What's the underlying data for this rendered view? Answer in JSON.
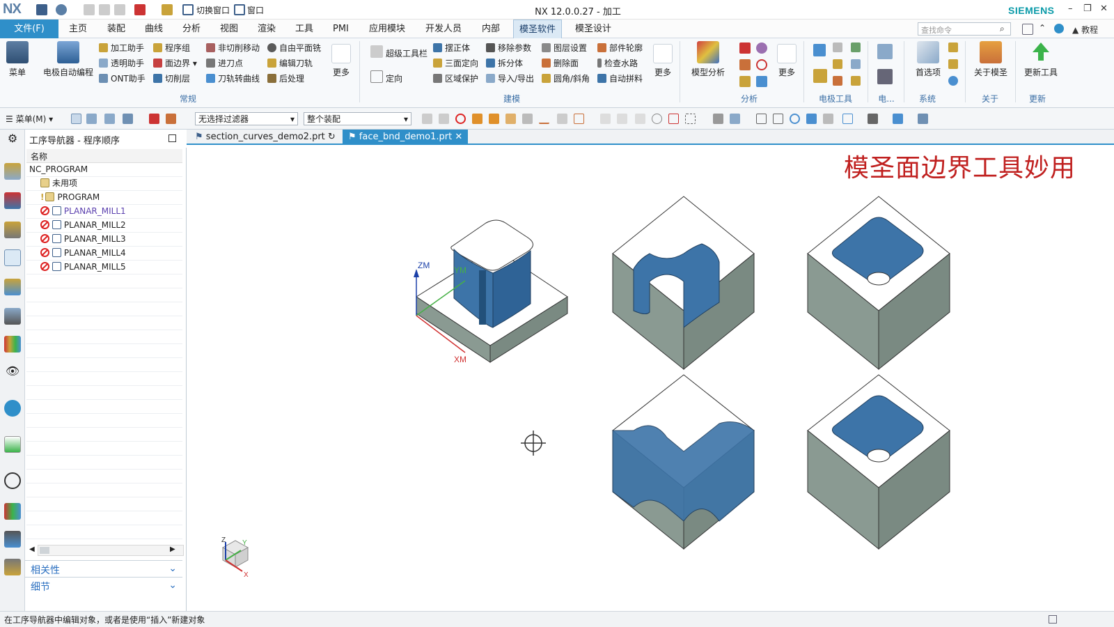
{
  "title_bar": {
    "logo": "NX",
    "window_title": "NX 12.0.0.27 - 加工",
    "switch_window_label": "切换窗口",
    "window_label": "窗口",
    "brand": "SIEMENS"
  },
  "menu": {
    "file_label": "文件(F)",
    "tabs": [
      "主页",
      "装配",
      "曲线",
      "分析",
      "视图",
      "渲染",
      "工具",
      "PMI",
      "应用模块",
      "开发人员",
      "内部",
      "模圣软件",
      "模圣设计"
    ],
    "active_tab": "模圣软件",
    "search_placeholder": "查找命令",
    "tutorial_label": "教程"
  },
  "ribbon": {
    "menu_label": "菜单",
    "electrode_prog": "电极自动编程",
    "col1": [
      "加工助手",
      "透明助手",
      "ONT助手"
    ],
    "col2": [
      "程序组",
      "面边界",
      "切削层"
    ],
    "col3": [
      "非切削移动",
      "进刀点",
      "刀轨转曲线"
    ],
    "col4": [
      "自由平面铣",
      "编辑刀轨",
      "后处理"
    ],
    "more1": "更多",
    "group_general": "常规",
    "super_toolbar": "超级工具栏",
    "orient": "定向",
    "col5": [
      "摆正体",
      "三面定向",
      "区域保护"
    ],
    "col6": [
      "移除参数",
      "拆分体",
      "导入/导出"
    ],
    "col7": [
      "图层设置",
      "删除面",
      "圆角/斜角"
    ],
    "col8": [
      "部件轮廓",
      "检查水路",
      "自动拼料"
    ],
    "more2": "更多",
    "group_modeling": "建模",
    "model_analysis": "模型分析",
    "more3": "更多",
    "group_analysis": "分析",
    "group_electrode": "电极工具",
    "group_e2": "电...",
    "preferences": "首选项",
    "group_system": "系统",
    "about_label": "关于模圣",
    "group_about": "关于",
    "update_label": "更新工具",
    "group_update": "更新"
  },
  "toolbar2": {
    "menu_label": "菜单(M)",
    "filter": "无选择过滤器",
    "assembly": "整个装配"
  },
  "navigator": {
    "title": "工序导航器 - 程序顺序",
    "column": "名称",
    "root": "NC_PROGRAM",
    "unused": "未用项",
    "program": "PROGRAM",
    "ops": [
      "PLANAR_MILL1",
      "PLANAR_MILL2",
      "PLANAR_MILL3",
      "PLANAR_MILL4",
      "PLANAR_MILL5"
    ],
    "dependency": "相关性",
    "details": "细节"
  },
  "file_tabs": [
    "section_curves_demo2.prt",
    "face_bnd_demo1.prt"
  ],
  "viewport": {
    "heading": "模圣面边界工具妙用",
    "axis_zm": "ZM",
    "axis_ym": "YM",
    "axis_xm": "XM",
    "triad_z": "Z",
    "triad_y": "Y",
    "triad_x": "X"
  },
  "status_bar": "在工序导航器中编辑对象，或者是使用“插入”新建对象",
  "colors": {
    "accent": "#2f8fc9",
    "face_blue": "#3d74a8",
    "body_gray": "#7e8e86",
    "heading_red": "#c0201f"
  }
}
